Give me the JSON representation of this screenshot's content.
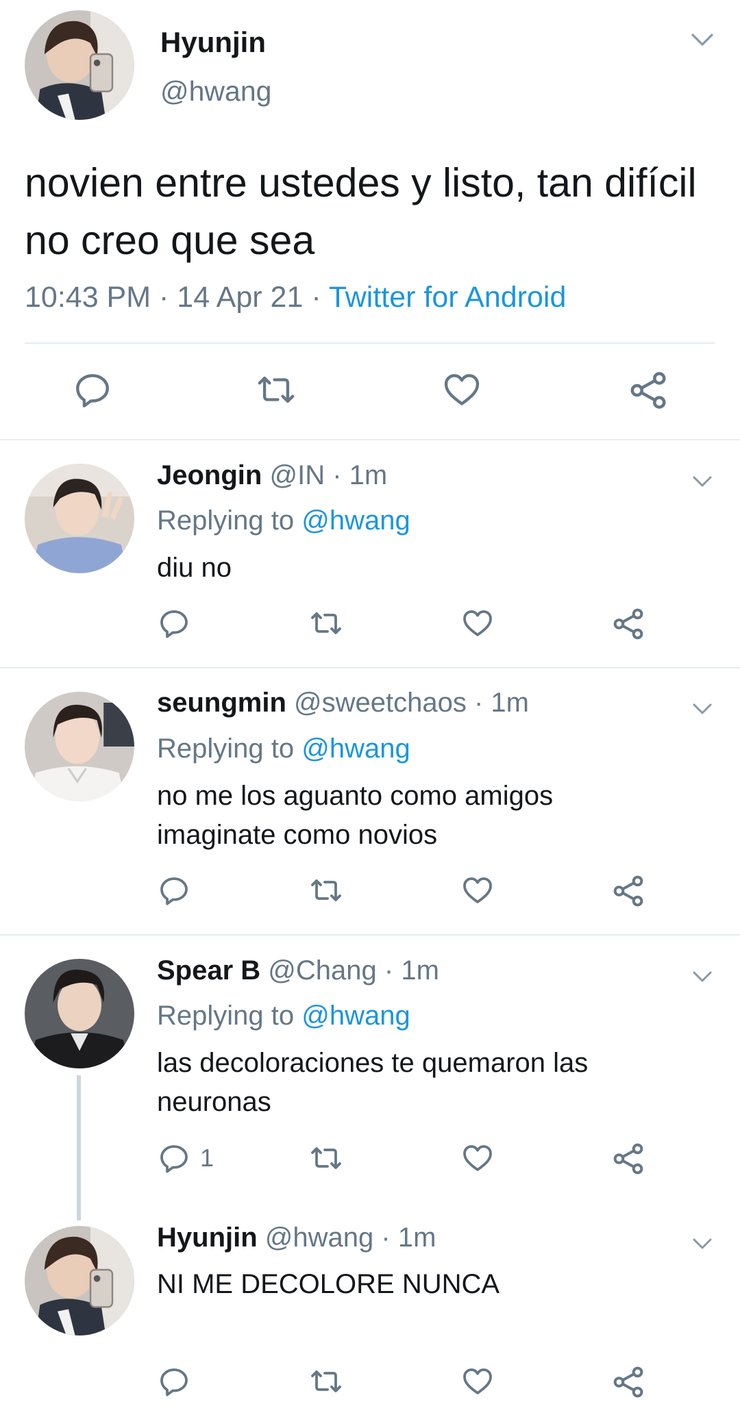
{
  "main_tweet": {
    "name": "Hyunjin",
    "handle": "@hwang",
    "text": "novien entre ustedes y listo, tan difícil no creo que sea",
    "time": "10:43 PM",
    "separator": " · ",
    "date": "14 Apr 21",
    "source": "Twitter for Android",
    "icons": [
      "chevron-down-icon",
      "reply-icon",
      "retweet-icon",
      "like-icon",
      "share-icon"
    ]
  },
  "replies": [
    {
      "name": "Jeongin",
      "handle": "@IN",
      "time": "1m",
      "replying_prefix": "Replying to ",
      "replying_to": "@hwang",
      "text": "diu no",
      "reply_count": ""
    },
    {
      "name": "seungmin",
      "handle": "@sweetchaos",
      "time": "1m",
      "replying_prefix": "Replying to ",
      "replying_to": "@hwang",
      "text": "no me los aguanto como amigos imaginate como novios",
      "reply_count": ""
    },
    {
      "name": "Spear B",
      "handle": "@Chang",
      "time": "1m",
      "replying_prefix": "Replying to ",
      "replying_to": "@hwang",
      "text": "las decoloraciones te quemaron las neuronas",
      "reply_count": "1"
    },
    {
      "name": "Hyunjin",
      "handle": "@hwang",
      "time": "1m",
      "text": "NI ME DECOLORE NUNCA",
      "reply_count": ""
    }
  ],
  "dot": " · ",
  "colors": {
    "text": "#14171a",
    "secondary": "#657786",
    "link": "#1b95e0",
    "divider": "#e6ecf0",
    "thread_line": "#ccd6dd"
  }
}
